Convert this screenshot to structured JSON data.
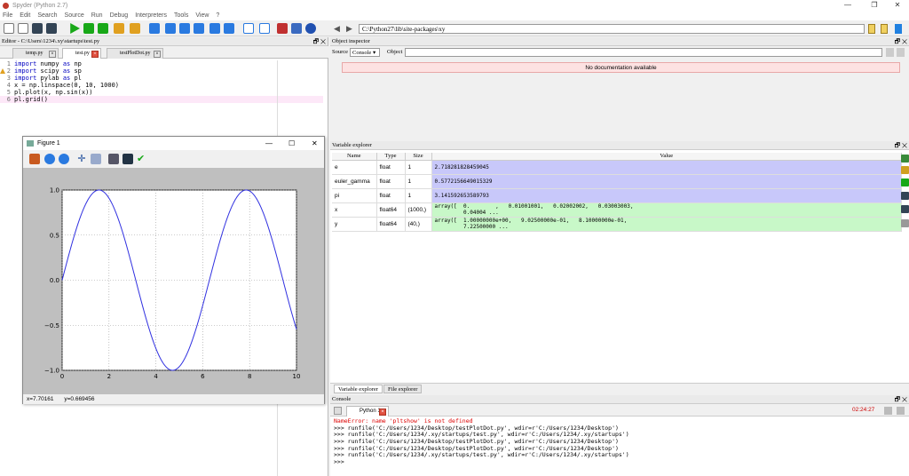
{
  "window": {
    "title": "Spyder (Python 2.7)",
    "min": "—",
    "restore": "❐",
    "close": "✕"
  },
  "menu": [
    "File",
    "Edit",
    "Search",
    "Source",
    "Run",
    "Debug",
    "Interpreters",
    "Tools",
    "View",
    "?"
  ],
  "toolbar": {
    "path": "C:\\Python27\\lib\\site-packages\\xy"
  },
  "editor": {
    "header": "Editor - C:\\Users\\1234\\.xy\\startups\\test.py",
    "controls": "🗗 ✕",
    "tabs": [
      {
        "label": "temp.py"
      },
      {
        "label": "test.py"
      },
      {
        "label": "testPlotDot.py"
      }
    ],
    "lines": [
      {
        "n": "1",
        "pre": "",
        "kw": "import",
        "post": " numpy ",
        "kw2": "as",
        "post2": " np"
      },
      {
        "n": "2",
        "pre": "",
        "kw": "import",
        "post": " scipy ",
        "kw2": "as",
        "post2": " sp"
      },
      {
        "n": "3",
        "pre": "",
        "kw": "import",
        "post": " pylab ",
        "kw2": "as",
        "post2": " pl"
      },
      {
        "n": "4",
        "pre": "x = np.linspace(0, 10, 1000)",
        "kw": "",
        "post": "",
        "kw2": "",
        "post2": ""
      },
      {
        "n": "5",
        "pre": "pl.plot(x, np.sin(x))",
        "kw": "",
        "post": "",
        "kw2": "",
        "post2": ""
      },
      {
        "n": "6",
        "pre": "pl.grid()",
        "kw": "",
        "post": "",
        "kw2": "",
        "post2": ""
      }
    ]
  },
  "figure": {
    "title": "Figure 1",
    "min": "—",
    "max": "☐",
    "close": "✕",
    "status_x": "x=7.70161",
    "status_y": "y=0.669456"
  },
  "chart_data": {
    "type": "line",
    "title": "",
    "xlabel": "",
    "ylabel": "",
    "xlim": [
      0,
      10
    ],
    "ylim": [
      -1.0,
      1.0
    ],
    "xticks": [
      "0",
      "2",
      "4",
      "6",
      "8",
      "10"
    ],
    "yticks": [
      "1.0",
      "0.5",
      "0.0",
      "−0.5",
      "−1.0"
    ],
    "grid": true,
    "series": [
      {
        "function": "sin(x)",
        "x_range": [
          0,
          10
        ],
        "color": "#3030e0"
      }
    ]
  },
  "object_inspector": {
    "header": "Object inspector",
    "controls": "🗗 ✕",
    "source_label": "Source",
    "source_value": "Console",
    "object_label": "Object",
    "message": "No documentation available"
  },
  "variable_explorer": {
    "header": "Variable explorer",
    "controls": "🗗 ✕",
    "columns": [
      "Name",
      "Type",
      "Size",
      "Value"
    ],
    "rows": [
      {
        "name": "e",
        "type": "float",
        "size": "1",
        "value": "2.718281828459045",
        "color": "blue"
      },
      {
        "name": "euler_gamma",
        "type": "float",
        "size": "1",
        "value": "0.5772156649015329",
        "color": "blue"
      },
      {
        "name": "pi",
        "type": "float",
        "size": "1",
        "value": "3.141592653589793",
        "color": "blue"
      },
      {
        "name": "x",
        "type": "float64",
        "size": "(1000,)",
        "value": "array([  0.        ,   0.01001001,   0.02002002,   0.03003003,\n         0.04004 ...",
        "color": "green"
      },
      {
        "name": "y",
        "type": "float64",
        "size": "(40,)",
        "value": "array([  1.00000000e+00,   9.02500000e-01,   8.10000000e-01,\n         7.22500000 ...",
        "color": "green"
      }
    ],
    "bottom_tabs": [
      "Variable explorer",
      "File explorer"
    ]
  },
  "console": {
    "header": "Console",
    "controls": "🗗 ✕",
    "tab": "Python 1",
    "time": "02:24:27",
    "lines": [
      {
        "text": "NameError: name 'pltshow' is not defined",
        "cls": "err"
      },
      {
        "text": ">>> runfile('C:/Users/1234/Desktop/testPlotDot.py', wdir=r'C:/Users/1234/Desktop')",
        "cls": ""
      },
      {
        "text": ">>> runfile('C:/Users/1234/.xy/startups/test.py', wdir=r'C:/Users/1234/.xy/startups')",
        "cls": ""
      },
      {
        "text": ">>> runfile('C:/Users/1234/Desktop/testPlotDot.py', wdir=r'C:/Users/1234/Desktop')",
        "cls": ""
      },
      {
        "text": ">>> runfile('C:/Users/1234/Desktop/testPlotDot.py', wdir=r'C:/Users/1234/Desktop')",
        "cls": ""
      },
      {
        "text": ">>> runfile('C:/Users/1234/.xy/startups/test.py', wdir=r'C:/Users/1234/.xy/startups')",
        "cls": ""
      },
      {
        "text": ">>> ",
        "cls": ""
      }
    ]
  }
}
